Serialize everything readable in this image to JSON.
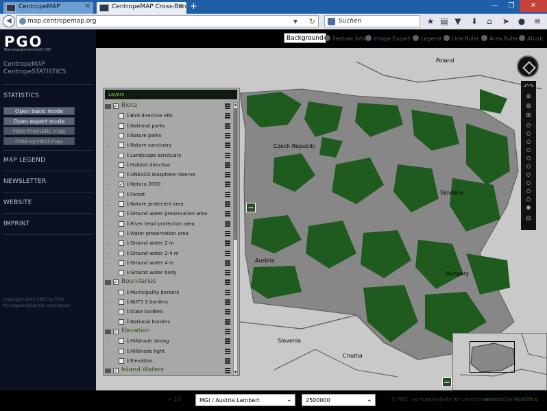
{
  "browser": {
    "tabs": [
      {
        "label": "CentropeMAP",
        "active": false
      },
      {
        "label": "CentropeMAP Cross-Borde...",
        "active": true
      }
    ],
    "new_tab": "+",
    "url": "map.centropemap.org",
    "search_placeholder": "Suchen"
  },
  "sidebar": {
    "logo": "PGO",
    "logo_sub": "Planungsgemeinschaft OST",
    "brand_map": "CentropeMAP",
    "brand_stats": "CentropeSTATISTICS",
    "statistics": "STATISTICS",
    "buttons": [
      "Open basic mode",
      "Open expert mode",
      "Hide thematic map",
      "Hide symbol map"
    ],
    "nav": [
      "MAP LEGEND",
      "NEWSLETTER",
      "WEBSITE",
      "IMPRINT"
    ],
    "copyright": "Copyright 2007-2015 by PGO",
    "responsibility": "No responsibility for correctness"
  },
  "toolbar": {
    "background": "Background",
    "tools": [
      "Feature Info",
      "Image Export",
      "Legend",
      "Line Ruler",
      "Area Ruler"
    ],
    "about": "About"
  },
  "map": {
    "countries": [
      "Poland",
      "Czech Republic",
      "Slovakia",
      "Austria",
      "Hungary",
      "Slovenia",
      "Croatia"
    ],
    "colors": {
      "land": "#c9c9c9",
      "region": "#868686",
      "forest": "#1e5a1e"
    }
  },
  "layers": {
    "title": "Layers",
    "rows": [
      {
        "label": "Biota",
        "group": true,
        "checked": true
      },
      {
        "label": "Bird directive SPA",
        "checked": false
      },
      {
        "label": "National parks",
        "checked": false
      },
      {
        "label": "Nature parks",
        "checked": false
      },
      {
        "label": "Nature sanctuary",
        "checked": false
      },
      {
        "label": "Landscape sanctuary",
        "checked": false
      },
      {
        "label": "Habitat directive",
        "checked": false
      },
      {
        "label": "UNESCO biosphere reserve",
        "checked": false
      },
      {
        "label": "Natura 2000",
        "checked": true
      },
      {
        "label": "Forest",
        "checked": false
      },
      {
        "label": "Nature protected area",
        "checked": false
      },
      {
        "label": "Ground water preservation area",
        "checked": false
      },
      {
        "label": "River head protection area",
        "checked": false
      },
      {
        "label": "Water preservation area",
        "checked": false
      },
      {
        "label": "Ground water 2 m",
        "checked": false
      },
      {
        "label": "Ground water 2-4 m",
        "checked": false
      },
      {
        "label": "Ground water 4 m",
        "checked": false
      },
      {
        "label": "Ground water body",
        "checked": false
      },
      {
        "label": "Boundaries",
        "group": true,
        "checked": true
      },
      {
        "label": "Municipality borders",
        "checked": false
      },
      {
        "label": "NUTS 3 borders",
        "checked": false
      },
      {
        "label": "State borders",
        "checked": false
      },
      {
        "label": "National borders",
        "checked": false
      },
      {
        "label": "Elevation",
        "group": true,
        "checked": true
      },
      {
        "label": "Hillshade strong",
        "checked": false
      },
      {
        "label": "Hillshade light",
        "checked": false
      },
      {
        "label": "Elevation",
        "checked": false
      },
      {
        "label": "Inland Waters",
        "group": true,
        "checked": true
      }
    ]
  },
  "bottom": {
    "projection": "MGI / Austria Lambert",
    "scale": "2500000",
    "credit": "© PGO - no responsibility for correctness",
    "powered": "powered by WebOffice",
    "coords": "+ 1/3"
  }
}
